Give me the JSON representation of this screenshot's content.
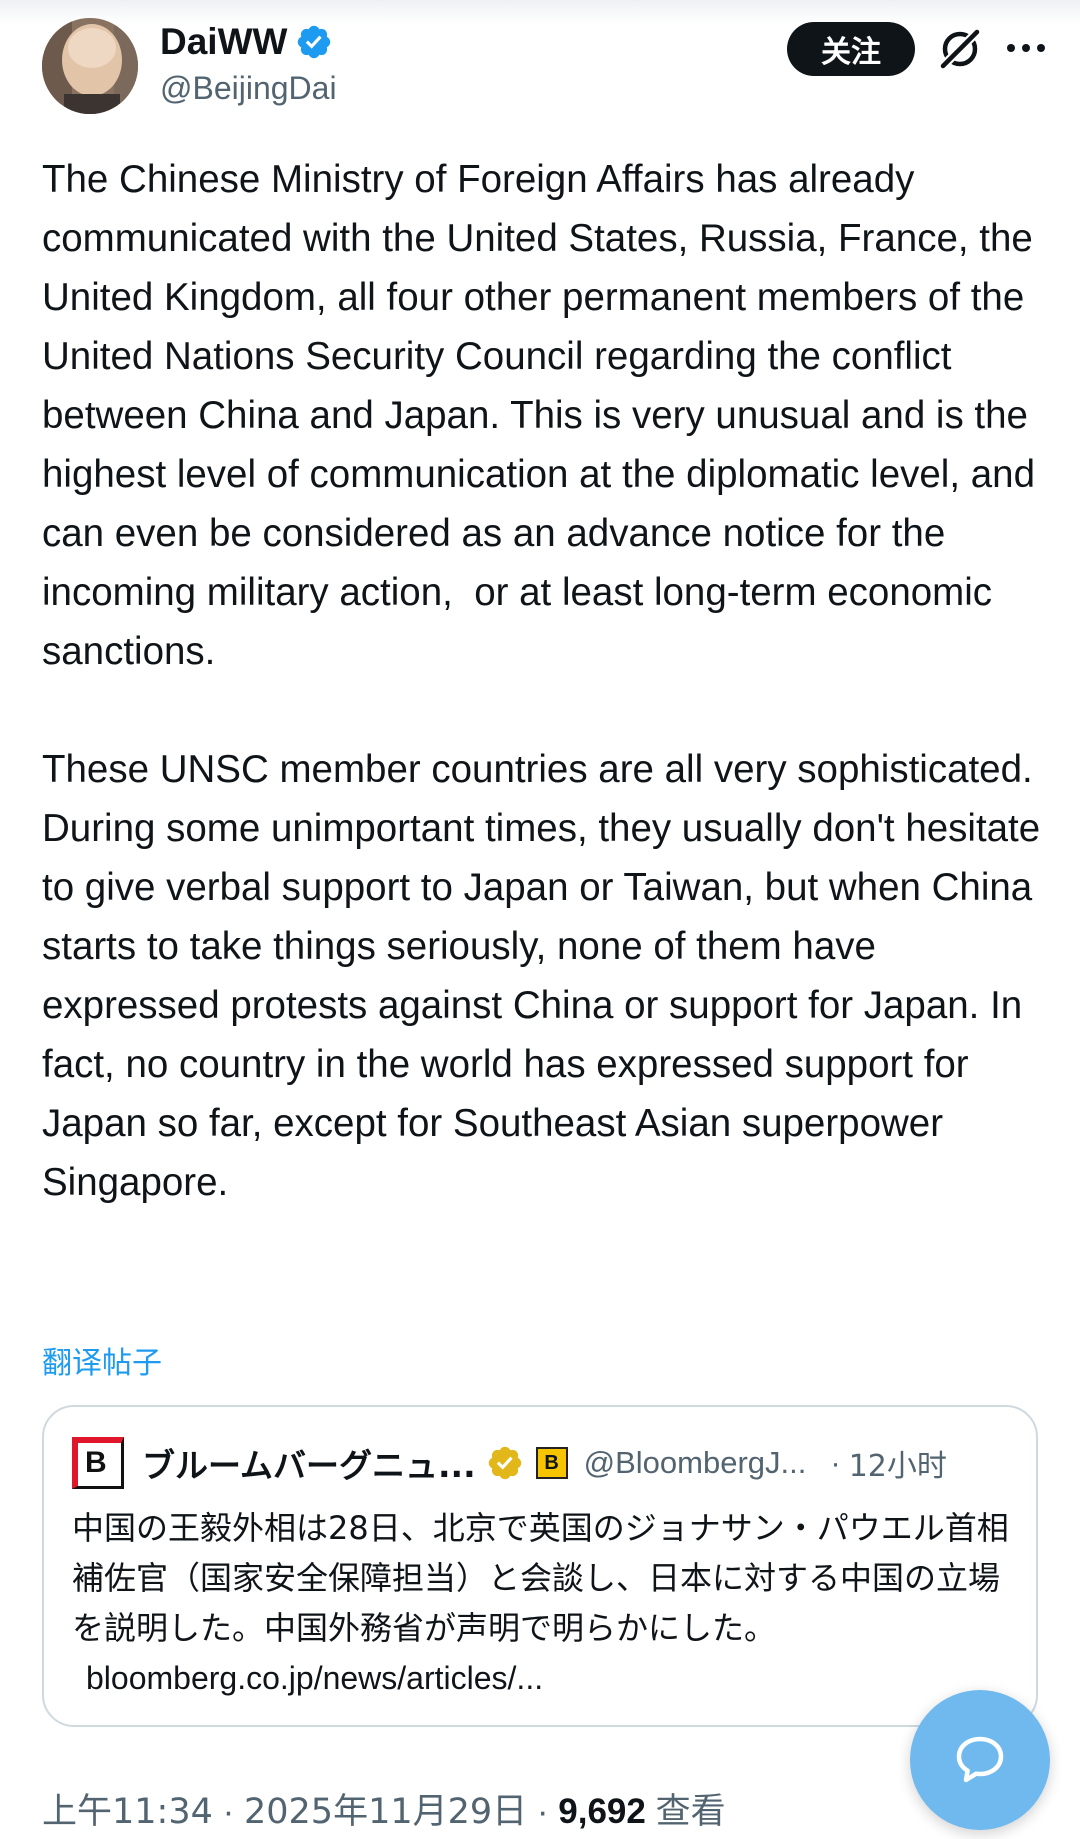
{
  "author": {
    "display_name": "DaiWW",
    "handle": "@BeijingDai",
    "verified": true
  },
  "actions": {
    "follow_label": "关注",
    "grok_icon": "grok-icon",
    "more_icon": "more-icon"
  },
  "post": {
    "text": "The Chinese Ministry of Foreign Affairs has already communicated with the United States, Russia, France, the United Kingdom, all four other permanent members of the United Nations Security Council regarding the conflict between China and Japan. This is very unusual and is the highest level of communication at the diplomatic level, and can even be considered as an advance notice for the incoming military action,  or at least long-term economic sanctions.\n\nThese UNSC member countries are all very sophisticated. During some unimportant times, they usually don't hesitate to give verbal support to Japan or Taiwan, but when China starts to take things seriously, none of them have expressed protests against China or support for Japan. In fact, no country in the world has expressed support for Japan so far, except for Southeast Asian superpower Singapore.",
    "translate_label": "翻译帖子"
  },
  "quote": {
    "name": "ブルームバーグニュ...",
    "handle": "@BloombergJ...",
    "separator": "·",
    "time": "12小时",
    "badge_letter": "B",
    "text": "中国の王毅外相は28日、北京で英国のジョナサン・パウエル首相補佐官（国家安全保障担当）と会談し、日本に対する中国の立場を説明した。中国外務省が声明で明らかにした。",
    "link": "bloomberg.co.jp/news/articles/..."
  },
  "meta": {
    "time": "上午11:34",
    "separator": "·",
    "date": "2025年11月29日",
    "views_count": "9,692",
    "views_label": "查看"
  },
  "colors": {
    "text": "#0f1419",
    "secondary": "#536471",
    "link": "#1d9bf0",
    "fab": "#6fb9ef",
    "border": "#cfd9de"
  }
}
